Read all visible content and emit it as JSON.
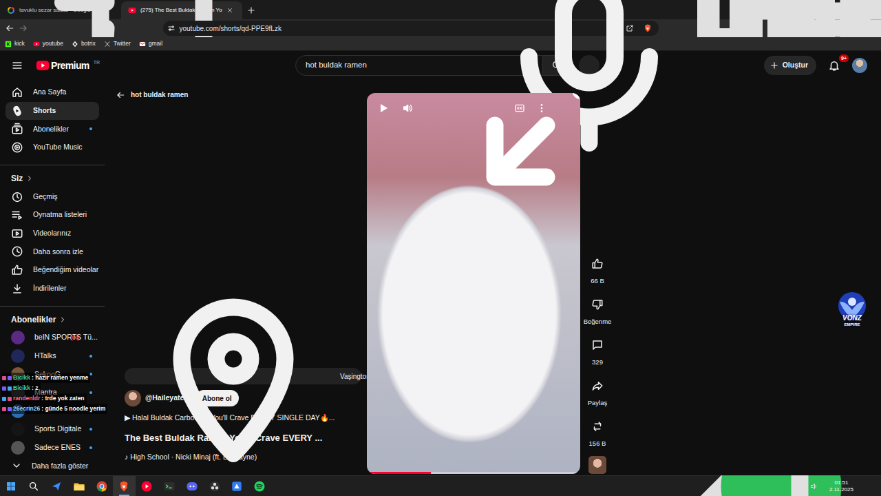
{
  "browser": {
    "tabs": [
      {
        "label": "tavuklu sezar salata - Google'da Ara",
        "selected": false
      },
      {
        "label": "(275) The Best Buldak Ramen Yo",
        "selected": true
      }
    ],
    "url": "youtube.com/shorts/qd-PPE9fLzk",
    "bookmarks": [
      "kick",
      "youtube",
      "botrix",
      "Twitter",
      "gmail"
    ]
  },
  "youtube": {
    "logo": "Premium",
    "region": "TR",
    "search": {
      "value": "hot buldak ramen"
    },
    "create": "Oluştur",
    "notifications": "9+",
    "sidebar": {
      "main": [
        {
          "label": "Ana Sayfa",
          "selected": false,
          "new": false
        },
        {
          "label": "Shorts",
          "selected": true,
          "new": false
        },
        {
          "label": "Abonelikler",
          "selected": false,
          "new": true
        },
        {
          "label": "YouTube Music",
          "selected": false,
          "new": false
        }
      ],
      "you": {
        "title": "Siz",
        "items": [
          {
            "label": "Geçmiş",
            "selected": false
          },
          {
            "label": "Oynatma listeleri",
            "selected": false
          },
          {
            "label": "Videolarınız",
            "selected": false
          },
          {
            "label": "Daha sonra izle",
            "selected": false
          },
          {
            "label": "Beğendiğim videolar",
            "selected": false
          },
          {
            "label": "İndirilenler",
            "selected": false
          }
        ]
      },
      "subscriptions": {
        "title": "Abonelikler",
        "channels": [
          {
            "name": "beIN SPORTS Tü...",
            "live": true,
            "new": false
          },
          {
            "name": "HTalks",
            "live": false,
            "new": true
          },
          {
            "name": "SekooG",
            "live": false,
            "new": true
          },
          {
            "name": "Mantra",
            "live": false,
            "new": true
          },
          {
            "live": false,
            "new": true
          },
          {
            "name": "Sports Digitale",
            "live": false,
            "new": true
          },
          {
            "name": "Sadece ENES",
            "live": false,
            "new": true
          }
        ],
        "more": "Daha fazla göster"
      }
    },
    "back": "hot buldak ramen",
    "short": {
      "playing": false,
      "progress": 0.3,
      "location": "Vaşington",
      "channel": "@Haileyateit",
      "subscribe": "Abone ol",
      "related": "▶ Halal Buldak Carbonara You'll Crave EVERY SINGLE DAY🔥...",
      "title": "The Best Buldak Ramen You'll Crave EVERY ...",
      "music": "♪ High School · Nicki Minaj (ft. Lil Wayne)",
      "actions": [
        {
          "label": "66 B"
        },
        {
          "label": "Beğenme"
        },
        {
          "label": "329"
        },
        {
          "label": "Paylaş"
        },
        {
          "label": "156 B"
        }
      ]
    }
  },
  "overlay": {
    "chat": [
      {
        "user": "Bicikk",
        "message": ": hazır ramen yenme",
        "color": "#3fc9a0"
      },
      {
        "user": "Bicikk",
        "message": ": z",
        "color": "#3fc9a0"
      },
      {
        "user": "randenldr",
        "message": ": trde yok zaten",
        "color": "#ff6b8a"
      },
      {
        "user": "26ecrin26",
        "message": ": günde 5 noodle yerim",
        "color": "#9fd3ff"
      }
    ],
    "logo": {
      "line1": "VONZ",
      "line2": "EMPIRE"
    }
  },
  "taskbar": {
    "apps": [
      {
        "selected": false
      },
      {
        "selected": false
      },
      {
        "selected": false
      },
      {
        "selected": true
      },
      {
        "selected": false
      },
      {
        "selected": false
      },
      {
        "selected": false
      },
      {
        "selected": false
      },
      {
        "selected": false
      },
      {
        "selected": false
      }
    ],
    "time": "01:51",
    "date": "2.11.2025"
  }
}
